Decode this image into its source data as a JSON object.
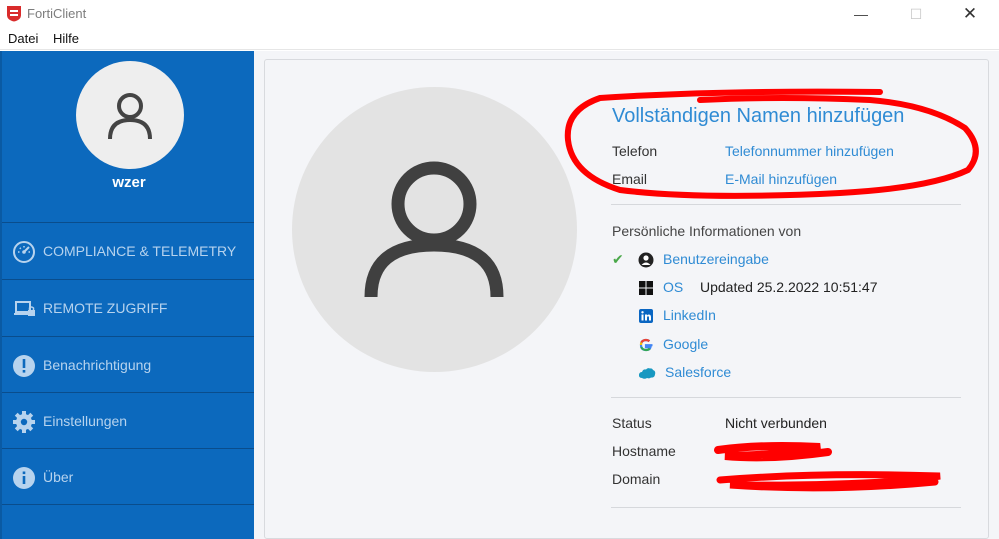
{
  "window": {
    "title": "FortiClient"
  },
  "menu": {
    "items": [
      "Datei",
      "Hilfe"
    ]
  },
  "sidebar": {
    "username": "wzer",
    "items": [
      {
        "label": "COMPLIANCE & TELEMETRY",
        "icon": "gauge-icon"
      },
      {
        "label": "REMOTE ZUGRIFF",
        "icon": "laptop-lock-icon"
      },
      {
        "label": "Benachrichtigung",
        "icon": "exclamation-icon"
      },
      {
        "label": "Einstellungen",
        "icon": "gear-icon"
      },
      {
        "label": "Über",
        "icon": "info-icon"
      }
    ]
  },
  "profile": {
    "full_name_link": "Vollständigen Namen hinzufügen",
    "phone_label": "Telefon",
    "phone_link": "Telefonnummer hinzufügen",
    "email_label": "Email",
    "email_link": "E-Mail hinzufügen",
    "sources_title": "Persönliche Informationen von",
    "sources": [
      {
        "label": "Benutzereingabe",
        "icon": "user-circle-icon",
        "checked": true,
        "extra": ""
      },
      {
        "label": "OS",
        "icon": "windows-icon",
        "checked": false,
        "extra": "Updated 25.2.2022 10:51:47"
      },
      {
        "label": "LinkedIn",
        "icon": "linkedin-icon",
        "checked": false,
        "extra": ""
      },
      {
        "label": "Google",
        "icon": "google-icon",
        "checked": false,
        "extra": ""
      },
      {
        "label": "Salesforce",
        "icon": "salesforce-icon",
        "checked": false,
        "extra": ""
      }
    ],
    "status_label": "Status",
    "status_value": "Nicht verbunden",
    "hostname_label": "Hostname",
    "hostname_value": "",
    "domain_label": "Domain",
    "domain_value": ""
  },
  "colors": {
    "sidebar_bg": "#0c69bd",
    "link": "#2f8bd4",
    "annotation_red": "#ff0000",
    "check_green": "#4aa84a"
  }
}
